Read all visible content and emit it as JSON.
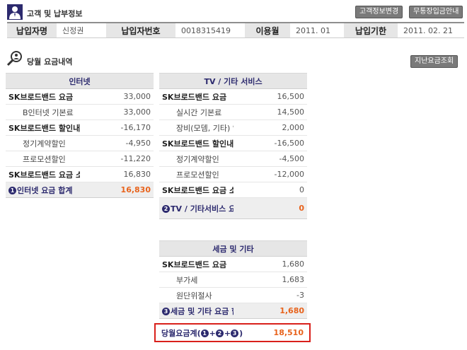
{
  "header": {
    "title": "고객 및 납부정보",
    "buttons": [
      "고객정보변경",
      "무통장입금안내"
    ]
  },
  "info": {
    "payer_label": "납입자명",
    "payer_value": "신정권",
    "payer_no_label": "납입자번호",
    "payer_no_value": "0018315419",
    "month_label": "이용월",
    "month_value": "2011. 01",
    "due_label": "납입기한",
    "due_value": "2011. 02. 21"
  },
  "section": {
    "title": "당월 요금내역",
    "history_button": "지난요금조회"
  },
  "internet": {
    "header": "인터넷",
    "rows": [
      {
        "label": "SK브로드밴드 요금",
        "amount": "33,000",
        "kind": "main"
      },
      {
        "label": "B인터넷 기본료",
        "amount": "33,000",
        "kind": "sub"
      },
      {
        "label": "SK브로드밴드 할인내역",
        "amount": "-16,170",
        "kind": "main"
      },
      {
        "label": "정기계약할인",
        "amount": "-4,950",
        "kind": "sub"
      },
      {
        "label": "프로모션할인",
        "amount": "-11,220",
        "kind": "sub"
      },
      {
        "label": "SK브로드밴드 요금 소계",
        "amount": "16,830",
        "kind": "main"
      }
    ],
    "total_num": "1",
    "total_label": "인터넷 요금 합계",
    "total_amount": "16,830"
  },
  "tv": {
    "header": "TV / 기타 서비스",
    "rows": [
      {
        "label": "SK브로드밴드 요금",
        "amount": "16,500",
        "kind": "main"
      },
      {
        "label": "실시간 기본료",
        "amount": "14,500",
        "kind": "sub"
      },
      {
        "label": "장비(모뎀, 기타) 임대료",
        "amount": "2,000",
        "kind": "sub"
      },
      {
        "label": "SK브로드밴드 할인내역",
        "amount": "-16,500",
        "kind": "main"
      },
      {
        "label": "정기계약할인",
        "amount": "-4,500",
        "kind": "sub"
      },
      {
        "label": "프로모션할인",
        "amount": "-12,000",
        "kind": "sub"
      },
      {
        "label": "SK브로드밴드 요금 소계",
        "amount": "0",
        "kind": "main"
      }
    ],
    "total_num": "2",
    "total_label": "TV / 기타서비스 요금 합계",
    "total_amount": "0"
  },
  "tax": {
    "header": "세금 및 기타",
    "rows": [
      {
        "label": "SK브로드밴드 요금",
        "amount": "1,680",
        "kind": "main"
      },
      {
        "label": "부가세",
        "amount": "1,683",
        "kind": "sub"
      },
      {
        "label": "원단위절사",
        "amount": "-3",
        "kind": "sub"
      }
    ],
    "total_num": "3",
    "total_label": "세금 및 기타 요금 합계",
    "total_amount": "1,680"
  },
  "grand_total": {
    "label_prefix": "당월요금계(",
    "label_suffix": ")",
    "amount": "18,510"
  }
}
